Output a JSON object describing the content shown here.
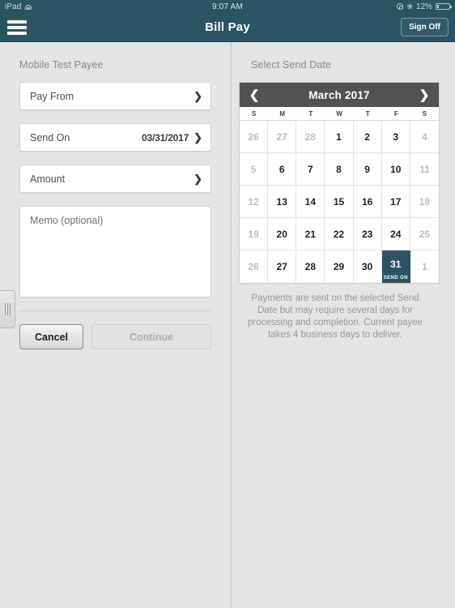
{
  "status_bar": {
    "device": "iPad",
    "wifi_icon": "wifi-icon",
    "time": "9:07 AM",
    "rotation_lock_icon": "rotation-lock-icon",
    "bluetooth_icon": "bluetooth-icon",
    "battery_percent": "12%",
    "battery_icon": "battery-icon"
  },
  "nav": {
    "menu_icon": "hamburger-menu-icon",
    "title": "Bill Pay",
    "sign_off_label": "Sign Off"
  },
  "left_pane": {
    "payee_title": "Mobile Test Payee",
    "fields": [
      {
        "label": "Pay From",
        "value": "",
        "chevron_icon": "chevron-right-icon"
      },
      {
        "label": "Send On",
        "value": "03/31/2017",
        "chevron_icon": "chevron-right-icon"
      },
      {
        "label": "Amount",
        "value": "",
        "chevron_icon": "chevron-right-icon"
      }
    ],
    "memo_placeholder": "Memo (optional)",
    "cancel_label": "Cancel",
    "continue_label": "Continue",
    "drag_handle_icon": "drag-handle-icon"
  },
  "right_pane": {
    "title": "Select Send Date",
    "calendar": {
      "prev_icon": "chevron-left-icon",
      "next_icon": "chevron-right-icon",
      "month_label": "March 2017",
      "weekdays": [
        "S",
        "M",
        "T",
        "W",
        "T",
        "F",
        "S"
      ],
      "selected_tag": "SEND ON",
      "days": [
        {
          "n": "26",
          "dim": true
        },
        {
          "n": "27",
          "dim": true
        },
        {
          "n": "28",
          "dim": true
        },
        {
          "n": "1",
          "dim": false
        },
        {
          "n": "2",
          "dim": false
        },
        {
          "n": "3",
          "dim": false
        },
        {
          "n": "4",
          "dim": true
        },
        {
          "n": "5",
          "dim": true
        },
        {
          "n": "6",
          "dim": false
        },
        {
          "n": "7",
          "dim": false
        },
        {
          "n": "8",
          "dim": false
        },
        {
          "n": "9",
          "dim": false
        },
        {
          "n": "10",
          "dim": false
        },
        {
          "n": "11",
          "dim": true
        },
        {
          "n": "12",
          "dim": true
        },
        {
          "n": "13",
          "dim": false
        },
        {
          "n": "14",
          "dim": false
        },
        {
          "n": "15",
          "dim": false
        },
        {
          "n": "16",
          "dim": false
        },
        {
          "n": "17",
          "dim": false
        },
        {
          "n": "18",
          "dim": true
        },
        {
          "n": "19",
          "dim": true
        },
        {
          "n": "20",
          "dim": false
        },
        {
          "n": "21",
          "dim": false
        },
        {
          "n": "22",
          "dim": false
        },
        {
          "n": "23",
          "dim": false
        },
        {
          "n": "24",
          "dim": false
        },
        {
          "n": "25",
          "dim": true
        },
        {
          "n": "26",
          "dim": true
        },
        {
          "n": "27",
          "dim": false
        },
        {
          "n": "28",
          "dim": false
        },
        {
          "n": "29",
          "dim": false
        },
        {
          "n": "30",
          "dim": false
        },
        {
          "n": "31",
          "dim": false,
          "selected": true
        },
        {
          "n": "1",
          "dim": true
        }
      ]
    },
    "note": "Payments are sent on the selected Send Date but may require several days for processing and completion. Current payee takes 4 business days to deliver."
  },
  "colors": {
    "teal": "#2b5463",
    "calendar_header": "#525252",
    "page_background": "#e4e4e4"
  }
}
